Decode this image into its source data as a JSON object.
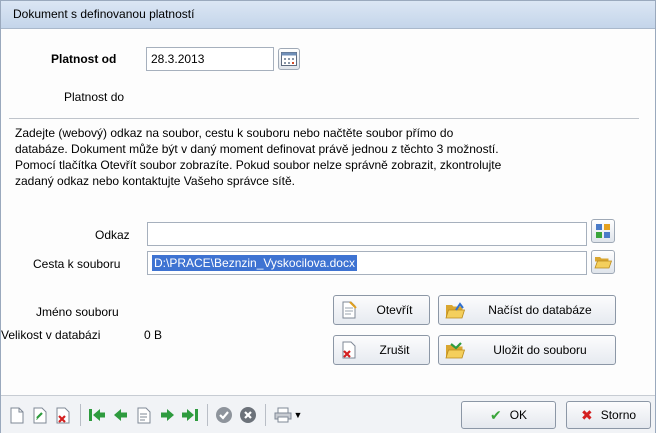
{
  "window": {
    "title": "Dokument s definovanou platností"
  },
  "validity": {
    "from_label": "Platnost od",
    "from_value": "28.3.2013",
    "to_label": "Platnost do"
  },
  "description": [
    "Zadejte (webový) odkaz na soubor, cestu k souboru nebo načtěte soubor přímo do",
    "databáze.  Dokument může být v daný moment definovat právě jednou z těchto 3 možností.",
    "Pomocí tlačítka Otevřít soubor zobrazíte. Pokud soubor nelze správně zobrazit, zkontrolujte",
    "zadaný odkaz nebo kontaktujte Vašeho správce sítě."
  ],
  "link": {
    "label": "Odkaz",
    "value": ""
  },
  "path": {
    "label": "Cesta k souboru",
    "value": "D:\\PRACE\\Beznzin_Vyskocilova.docx"
  },
  "file_info": {
    "name_label": "Jméno souboru",
    "size_label": "Velikost v databázi",
    "size_value": "0 B"
  },
  "buttons": {
    "open": "Otevřít",
    "load_db": "Načíst do databáze",
    "cancel": "Zrušit",
    "save_file": "Uložit do souboru"
  },
  "footer": {
    "ok": "OK",
    "storno": "Storno"
  },
  "icons": {
    "calendar": "calendar-icon",
    "browse_web": "browse-link-icon",
    "folder": "folder-open-icon"
  },
  "colors": {
    "selection": "#3e73d2",
    "ok_check": "#3aa53a",
    "storno_x": "#d42020",
    "nav_arrow": "#2e9b3e"
  }
}
